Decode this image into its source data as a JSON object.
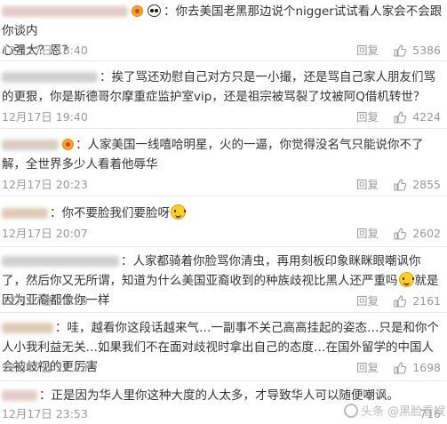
{
  "actions": {
    "reply_label": "回复"
  },
  "comments": [
    {
      "text_a": "：你去美国老黑那边说个nigger试试看人家会不会跟你谈内",
      "text_b": "心强大？恩？",
      "time": "12月17日 18:40",
      "likes": "5386",
      "badge_icon": "vip-badge-icon",
      "emoji_icon": "panda-emoji-icon"
    },
    {
      "text": "：挨了骂还劝慰自己对方只是一小撮，还是骂自己家人朋友们骂的更狠，你是斯德哥尔摩重症监护室vip，还是祖宗被骂裂了坟被阿Q借机转世？",
      "time": "12月17日 19:40",
      "likes": "4224"
    },
    {
      "text": "：人家美国一线嘻哈明星，火的一逼，你觉得没名气只能说你不了解，全世界多少人看着他辱华",
      "time": "12月17日 20:23",
      "likes": "2855",
      "badge_icon": "vip-badge-icon"
    },
    {
      "text": "：你不要脸我们要脸呀",
      "time": "12月17日 20:07",
      "likes": "2602",
      "emoji_icon": "smile-emoji-icon"
    },
    {
      "text_a": "：人家都骑着你脸骂你清虫，再用刻板印象眯眯眼嘲讽你了，然后你又无所谓，知道为什么美国亚裔收到的种族歧视比黑人还严重吗",
      "text_b": "就是因为亚裔都像你一样",
      "time": "12月17日 20:26",
      "likes": "2161",
      "emoji_icon": "wink-emoji-icon"
    },
    {
      "text": "：哇，越看你这段话越来气…一副事不关己高高挂起的姿态…只是和你个人小我利益无关…如果我们不在面对歧视时拿出自己的态度…在国外留学的中国人会被歧视的更厉害",
      "time": "12月17日 21:23",
      "likes": "1698"
    },
    {
      "text": "：正是因为华人里你这种大度的人太多，才导致华人可以随便嘲讽。",
      "time": "12月17日 23:53",
      "likes": "716"
    }
  ],
  "watermark": {
    "text": "头条 @黑脸看娱乐"
  }
}
